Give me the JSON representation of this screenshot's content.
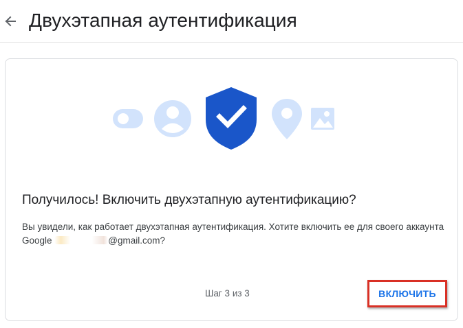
{
  "header": {
    "back_icon": "arrow-left-icon",
    "title": "Двухэтапная аутентификация"
  },
  "card": {
    "heading": "Получилось! Включить двухэтапную аутентификацию?",
    "description_prefix": "Вы увидели, как работает двухэтапная аутентификация. Хотите включить ее для своего аккаунта Google ",
    "email_suffix": "@gmail.com?",
    "step": "Шаг 3 из 3",
    "enable_button": "ВКЛЮЧИТЬ"
  },
  "illustration": {
    "icons": [
      "toggle-icon",
      "account-icon",
      "shield-check-icon",
      "location-pin-icon",
      "image-icon"
    ],
    "colors": {
      "light": "#d2e3fc",
      "shield": "#1a56c9",
      "check": "#ffffff"
    }
  },
  "colors": {
    "accent": "#1a73e8",
    "highlight_border": "#d93025"
  }
}
